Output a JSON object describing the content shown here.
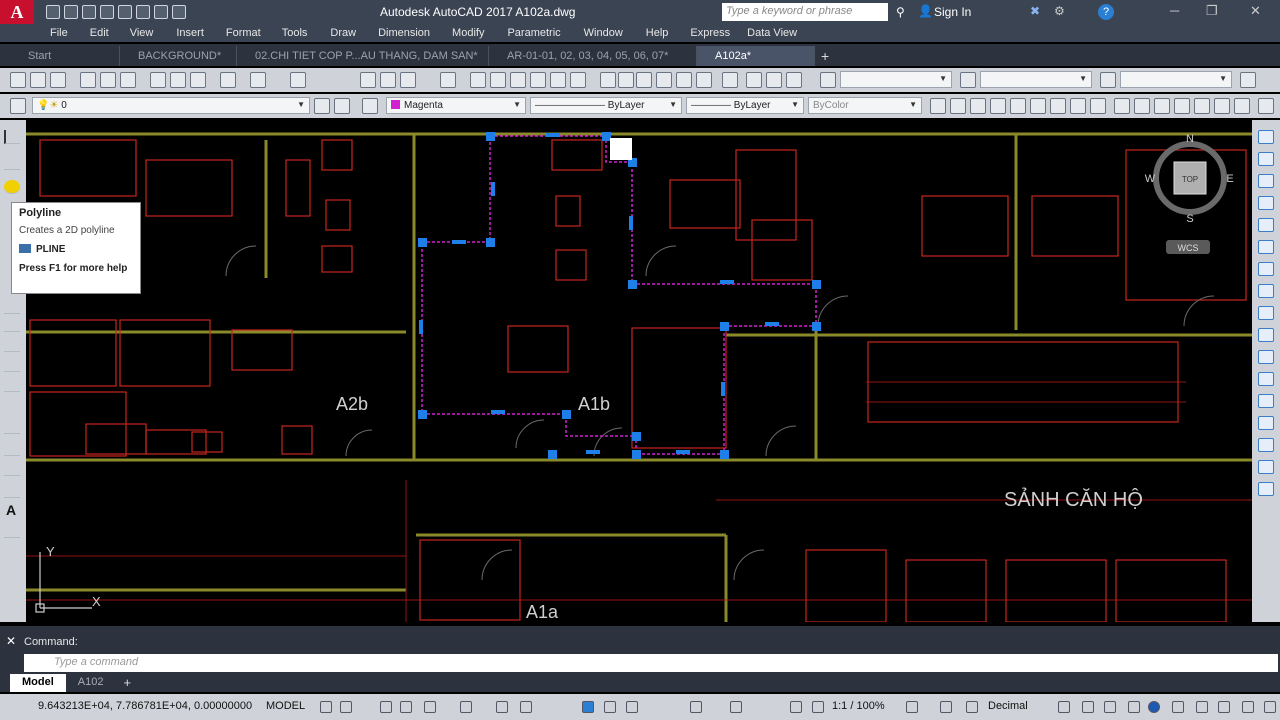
{
  "window": {
    "title": "Autodesk AutoCAD 2017    A102a.dwg",
    "search_placeholder": "Type a keyword or phrase",
    "sign_in": "Sign In",
    "app_letter": "A"
  },
  "menu": [
    "File",
    "Edit",
    "View",
    "Insert",
    "Format",
    "Tools",
    "Draw",
    "Dimension",
    "Modify",
    "Parametric",
    "Window",
    "Help",
    "Express",
    "Data View"
  ],
  "tabs": [
    {
      "label": "Start",
      "active": false
    },
    {
      "label": "BACKGROUND*",
      "active": false
    },
    {
      "label": "02.CHI TIET COP P...AU THANG, DAM SAN*",
      "active": false
    },
    {
      "label": "AR-01-01, 02, 03, 04, 05, 06, 07*",
      "active": false
    },
    {
      "label": "A102a*",
      "active": true
    }
  ],
  "properties": {
    "layer": "0",
    "color": "Magenta",
    "linetype": "ByLayer",
    "lineweight": "ByLayer",
    "plotstyle": "ByColor"
  },
  "tooltip": {
    "title": "Polyline",
    "description": "Creates a 2D polyline",
    "command": "PLINE",
    "help": "Press F1 for more help"
  },
  "drawing": {
    "labels": [
      "A2b",
      "A1b",
      "SẢNH CĂN HỘ",
      "A1a"
    ],
    "viewcube": {
      "top": "TOP",
      "n": "N",
      "s": "S",
      "e": "E",
      "w": "W",
      "wcs": "WCS"
    },
    "ucs": {
      "x": "X",
      "y": "Y"
    },
    "colors": {
      "wall": "#c7261f",
      "wall_alt": "#8a8a2a",
      "selection_grip": "#1e7fe8",
      "selected_line": "#d020d0",
      "hatch": "#b01818"
    }
  },
  "command": {
    "label": "Command:",
    "placeholder": "Type a command"
  },
  "layouts": [
    {
      "label": "Model",
      "active": true
    },
    {
      "label": "A102",
      "active": false
    }
  ],
  "status": {
    "coordinates": "9.643213E+04, 7.786781E+04, 0.00000000",
    "space": "MODEL",
    "scale": "1:1 / 100%",
    "units": "Decimal"
  }
}
